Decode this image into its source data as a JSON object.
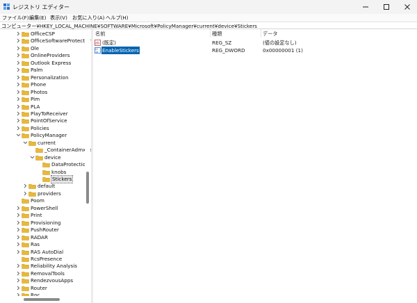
{
  "window": {
    "title": "レジストリ エディター",
    "controls": [
      "minimize-icon",
      "maximize-icon",
      "close-icon"
    ]
  },
  "menu": [
    "ファイル(F)",
    "編集(E)",
    "表示(V)",
    "お気に入り(A)",
    "ヘルプ(H)"
  ],
  "address": "コンピューター¥HKEY_LOCAL_MACHINE¥SOFTWARE¥Microsoft¥PolicyManager¥current¥device¥Stickers",
  "colors": {
    "folder": "#e8b83a",
    "selection": "#0063b1",
    "accent_icon": "#2e6fc2"
  },
  "tree": [
    {
      "label": "OfficeCSP",
      "expander": "collapsed"
    },
    {
      "label": "OfficeSoftwareProtection",
      "expander": "collapsed"
    },
    {
      "label": "Ole",
      "expander": "collapsed"
    },
    {
      "label": "OnlineProviders",
      "expander": "collapsed"
    },
    {
      "label": "Outlook Express",
      "expander": "collapsed"
    },
    {
      "label": "Palm",
      "expander": "collapsed"
    },
    {
      "label": "Personalization",
      "expander": "collapsed"
    },
    {
      "label": "Phone",
      "expander": "collapsed"
    },
    {
      "label": "Photos",
      "expander": "collapsed"
    },
    {
      "label": "Pim",
      "expander": "collapsed"
    },
    {
      "label": "PLA",
      "expander": "collapsed"
    },
    {
      "label": "PlayToReceiver",
      "expander": "collapsed"
    },
    {
      "label": "PointOfService",
      "expander": "collapsed"
    },
    {
      "label": "Policies",
      "expander": "collapsed"
    },
    {
      "label": "PolicyManager",
      "expander": "expanded"
    },
    {
      "label": "current",
      "expander": "expanded"
    },
    {
      "label": "_ContainerAdmxDefault",
      "expander": "none"
    },
    {
      "label": "device",
      "expander": "expanded"
    },
    {
      "label": "DataProtection",
      "expander": "none"
    },
    {
      "label": "knobs",
      "expander": "none"
    },
    {
      "label": "Stickers",
      "expander": "none",
      "selected": true
    },
    {
      "label": "default",
      "expander": "collapsed"
    },
    {
      "label": "providers",
      "expander": "collapsed"
    },
    {
      "label": "Poom",
      "expander": "none"
    },
    {
      "label": "PowerShell",
      "expander": "collapsed"
    },
    {
      "label": "Print",
      "expander": "collapsed"
    },
    {
      "label": "Provisioning",
      "expander": "collapsed"
    },
    {
      "label": "PushRouter",
      "expander": "collapsed"
    },
    {
      "label": "RADAR",
      "expander": "collapsed"
    },
    {
      "label": "Ras",
      "expander": "collapsed"
    },
    {
      "label": "RAS AutoDial",
      "expander": "collapsed"
    },
    {
      "label": "RcsPresence",
      "expander": "none"
    },
    {
      "label": "Reliability Analysis",
      "expander": "collapsed"
    },
    {
      "label": "RemovalTools",
      "expander": "collapsed"
    },
    {
      "label": "RendezvousApps",
      "expander": "collapsed"
    },
    {
      "label": "Router",
      "expander": "collapsed"
    },
    {
      "label": "Rpc",
      "expander": "collapsed"
    }
  ],
  "list": {
    "headers": {
      "name": "名前",
      "type": "種類",
      "data": "データ"
    },
    "rows": [
      {
        "name": "(既定)",
        "type": "REG_SZ",
        "data": "(値の設定なし)",
        "icon": "string-value-icon",
        "selected": false
      },
      {
        "name": "EnableStickers",
        "type": "REG_DWORD",
        "data": "0x00000001 (1)",
        "icon": "binary-value-icon",
        "selected": true
      }
    ]
  }
}
